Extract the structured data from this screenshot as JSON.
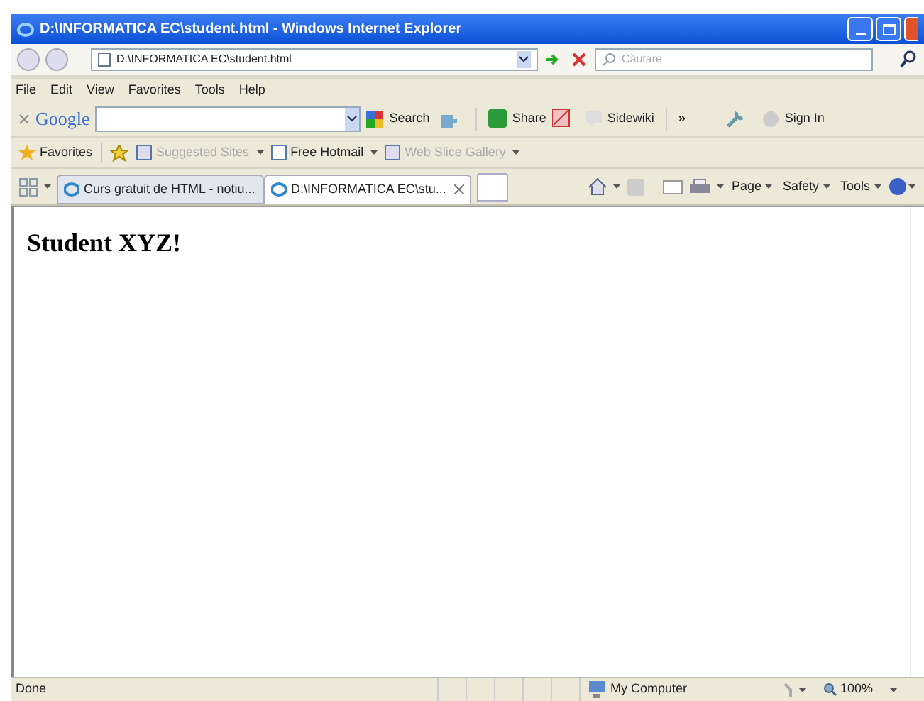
{
  "window": {
    "title": "D:\\INFORMATICA EC\\student.html - Windows Internet Explorer"
  },
  "address_bar": {
    "value": "D:\\INFORMATICA EC\\student.html"
  },
  "search": {
    "placeholder": "Căutare"
  },
  "menu": [
    "File",
    "Edit",
    "View",
    "Favorites",
    "Tools",
    "Help"
  ],
  "google_toolbar": {
    "logo": "Google",
    "search": "Search",
    "share": "Share",
    "sidewiki": "Sidewiki",
    "more": "»",
    "sign_in": "Sign In"
  },
  "favorites_bar": {
    "label": "Favorites",
    "links": [
      {
        "label": "Suggested Sites",
        "disabled": true
      },
      {
        "label": "Free Hotmail",
        "disabled": false
      },
      {
        "label": "Web Slice Gallery",
        "disabled": true
      }
    ]
  },
  "tabs": [
    {
      "label": "Curs gratuit de HTML - notiu...",
      "selected": false
    },
    {
      "label": "D:\\INFORMATICA EC\\stu...",
      "selected": true
    }
  ],
  "command_bar": [
    "Page",
    "Safety",
    "Tools"
  ],
  "page": {
    "heading": "Student XYZ!"
  },
  "status_bar": {
    "text": "Done",
    "zone": "My Computer",
    "zoom": "100%"
  }
}
